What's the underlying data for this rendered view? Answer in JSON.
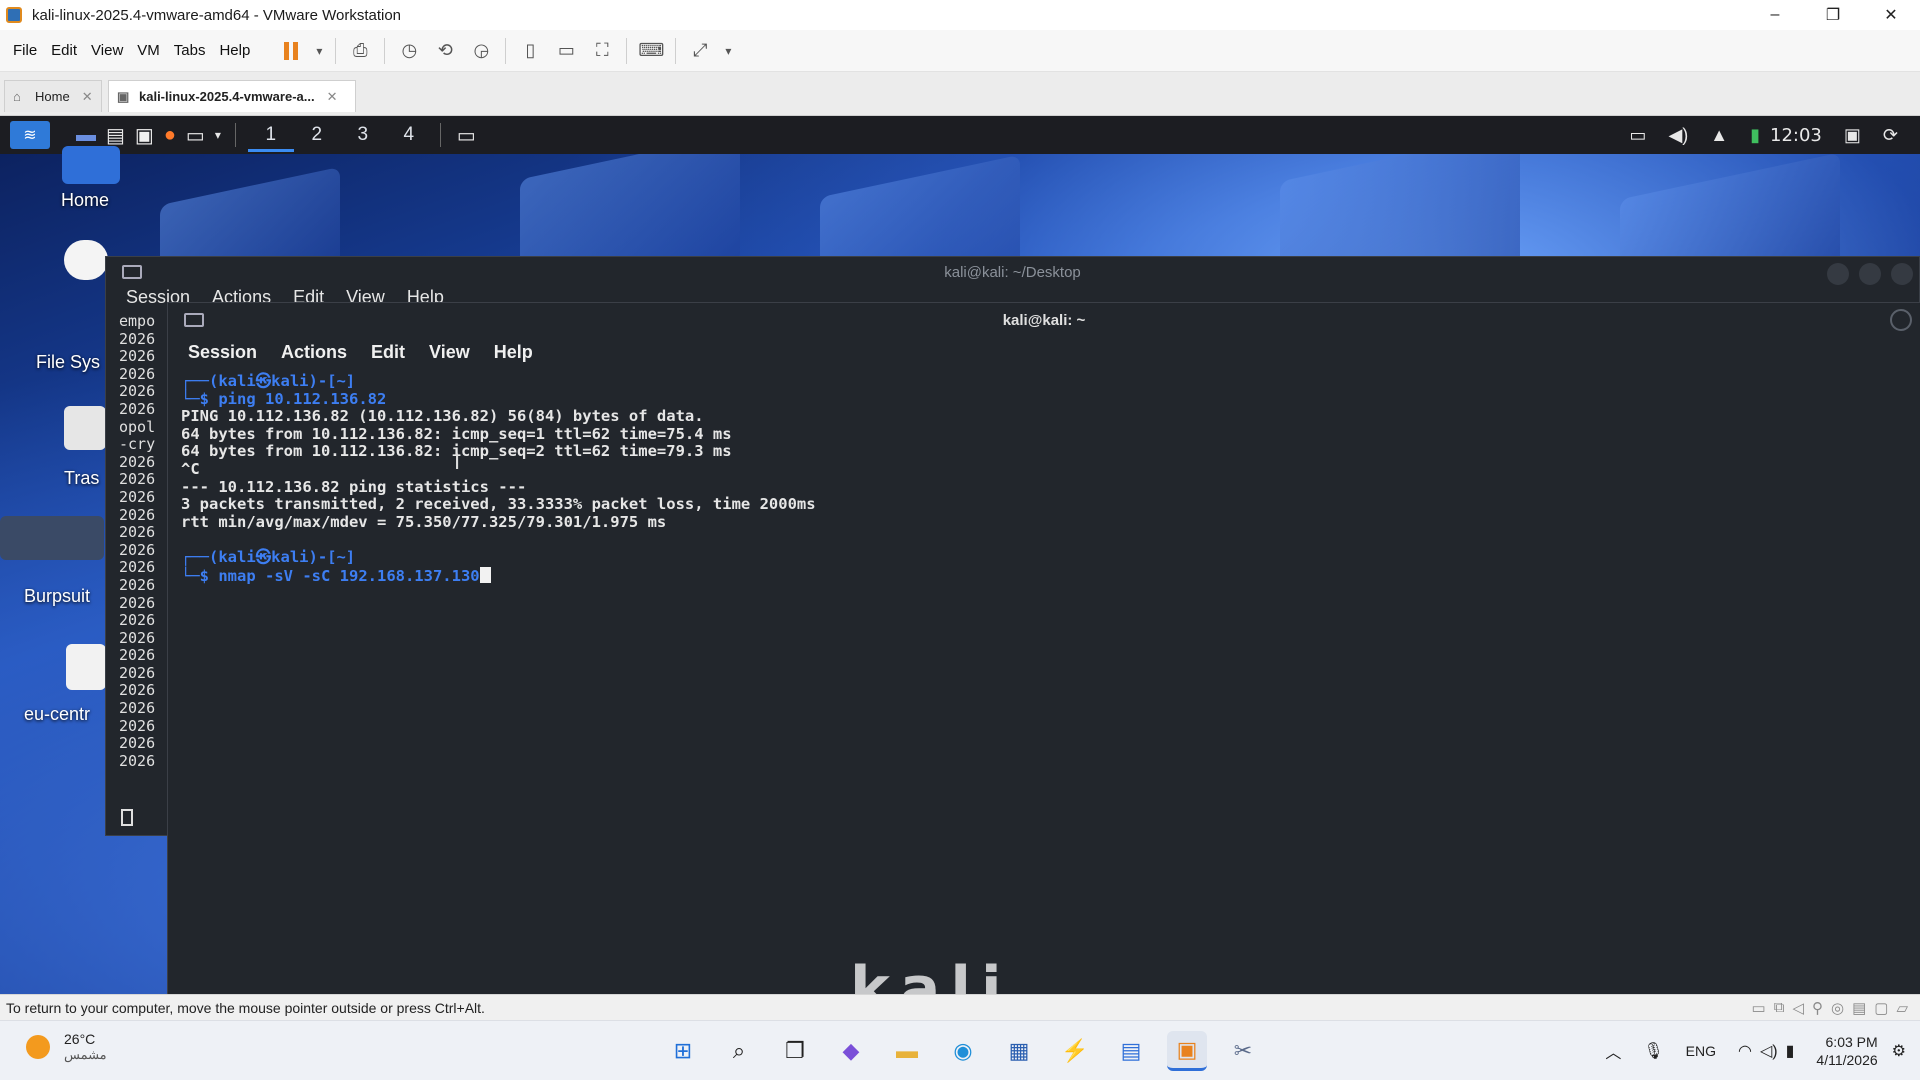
{
  "window": {
    "title": "kali-linux-2025.4-vmware-amd64 - VMware Workstation",
    "controls": [
      "–",
      "❐",
      "✕"
    ]
  },
  "menubar": {
    "items": [
      "File",
      "Edit",
      "View",
      "VM",
      "Tabs",
      "Help"
    ]
  },
  "tabs": [
    {
      "label": "Home",
      "active": false
    },
    {
      "label": "kali-linux-2025.4-vmware-a...",
      "active": true
    }
  ],
  "kali_panel": {
    "workspaces": [
      "1",
      "2",
      "3",
      "4"
    ],
    "clock": "12:03"
  },
  "desktop_icons": [
    {
      "label": "Home"
    },
    {
      "label": "File Sys"
    },
    {
      "label": "Tras"
    },
    {
      "label": "Burpsuit"
    },
    {
      "label": "eu-centr"
    }
  ],
  "terminal_back": {
    "title": "kali@kali: ~/Desktop",
    "menu": [
      "Session",
      "Actions",
      "Edit",
      "View",
      "Help"
    ],
    "lines": [
      "empo",
      "2026",
      "2026",
      "2026",
      "2026",
      "2026",
      "opol",
      "-cry",
      "2026",
      "2026",
      "2026",
      "2026",
      "2026",
      "2026",
      "2026",
      "2026",
      "2026",
      "2026",
      "2026",
      "2026",
      "2026",
      "2026",
      "2026",
      "2026",
      "2026",
      "2026"
    ]
  },
  "terminal_front": {
    "title": "kali@kali: ~",
    "menu": [
      "Session",
      "Actions",
      "Edit",
      "View",
      "Help"
    ],
    "prompt1_top": "┌──(kali㉿kali)-[~]",
    "prompt1_cmd": "ping 10.112.136.82",
    "output": [
      "PING 10.112.136.82 (10.112.136.82) 56(84) bytes of data.",
      "64 bytes from 10.112.136.82: icmp_seq=1 ttl=62 time=75.4 ms",
      "64 bytes from 10.112.136.82: icmp_seq=2 ttl=62 time=79.3 ms",
      "^C",
      "--- 10.112.136.82 ping statistics ---",
      "3 packets transmitted, 2 received, 33.3333% packet loss, time 2000ms",
      "rtt min/avg/max/mdev = 75.350/77.325/79.301/1.975 ms"
    ],
    "prompt2_top": "┌──(kali㉿kali)-[~]",
    "prompt2_cmd": "nmap -sV -sC 192.168.137.130",
    "prompt_bottom": "└─$"
  },
  "watermark": "kali",
  "statusbar": {
    "message": "To return to your computer, move the mouse pointer outside or press Ctrl+Alt."
  },
  "taskbar": {
    "weather_temp": "26°C",
    "weather_desc": "مشمس",
    "language": "ENG",
    "time": "6:03 PM",
    "date": "4/11/2026"
  }
}
